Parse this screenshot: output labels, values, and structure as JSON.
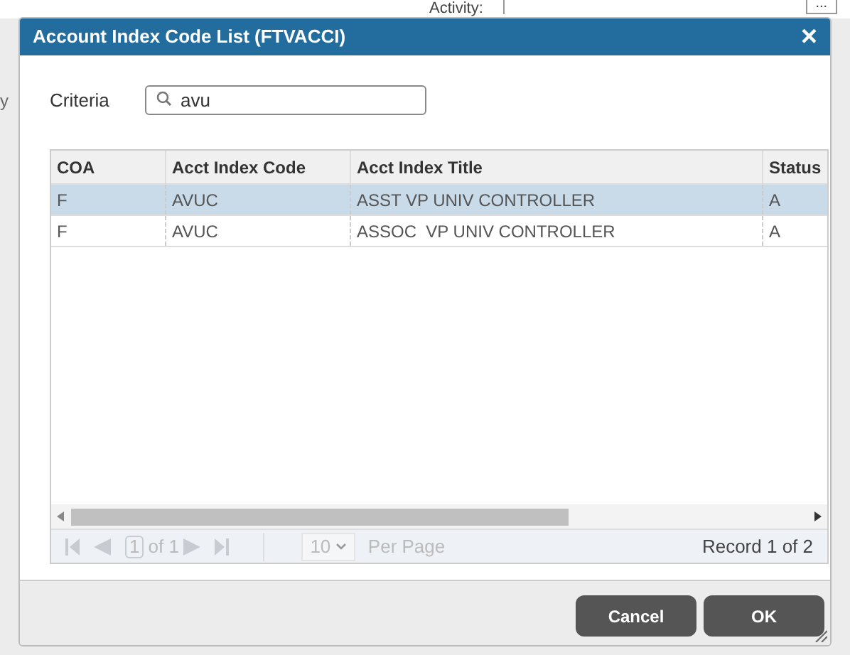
{
  "background": {
    "field_label": "Activity:",
    "lookup_button": "...",
    "side_text": "y"
  },
  "dialog": {
    "title": "Account Index Code List (FTVACCI)",
    "close": "×",
    "criteria": {
      "label": "Criteria",
      "value": "avu"
    },
    "table": {
      "columns": [
        "COA",
        "Acct Index Code",
        "Acct Index Title",
        "Status"
      ],
      "rows": [
        {
          "cells": [
            "F",
            "AVUC",
            "ASST VP UNIV CONTROLLER",
            "A"
          ],
          "selected": true
        },
        {
          "cells": [
            "F",
            "AVUC",
            "ASSOC  VP UNIV CONTROLLER",
            "A"
          ],
          "selected": false
        }
      ]
    },
    "pager": {
      "page": "1",
      "of": "of 1",
      "per_page": "10",
      "per_page_label": "Per Page",
      "record": "Record 1 of 2"
    },
    "buttons": [
      "Cancel",
      "OK"
    ]
  }
}
